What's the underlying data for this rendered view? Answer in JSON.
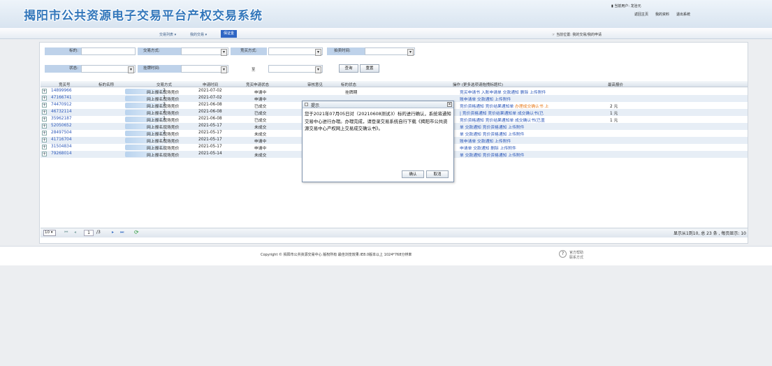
{
  "header": {
    "title": "揭阳市公共资源电子交易平台产权交易系统",
    "user": "▮ 当前用户: 龙治元",
    "links": [
      "返回主页",
      "我的资料",
      "退出系统"
    ]
  },
  "nav": {
    "items": [
      "交易列表 ▾",
      "我的交易 ▾"
    ],
    "active": "保证金",
    "location": "当前位置: 我的交易/我的申请"
  },
  "filters": {
    "target_label": "标的:",
    "trade_label": "交易方式:",
    "bid_label": "竞买方式:",
    "auction_label": "拍卖时间:",
    "status_label": "状态:",
    "list_label": "挂牌时间:",
    "to": "至",
    "query": "查询",
    "reset": "重置"
  },
  "table": {
    "headers": [
      "竞买号",
      "标的名称",
      "交易方式",
      "申请时间",
      "竞买申请状态",
      "审核意见",
      "标的状态",
      "操作 (更多选项请拖拽标题栏)",
      "最高报价"
    ],
    "rows": [
      {
        "id": "14899966",
        "nm": "2",
        "mode": "网上报名现场竞价",
        "date": "2021-07-02",
        "st": "申请中",
        "ts": "挂牌期",
        "ops": "竞买申请书 入账申请单 交款通知 删除 上传附件",
        "opx": "",
        "price": ""
      },
      {
        "id": "47166741",
        "nm": "1",
        "mode": "网上报名现场竞价",
        "date": "2021-07-02",
        "st": "申请中",
        "ts": "",
        "ops": "账申请单 交款通知 上传附件",
        "opx": "",
        "price": ""
      },
      {
        "id": "74470912",
        "nm": "3",
        "mode": "网上报名现场竞价",
        "date": "2021-06-08",
        "st": "已成交",
        "ts": "",
        "ops": "竞价资格通知 竞价结果通知单",
        "opx": "办理成交确认书 上",
        "price": "2 元"
      },
      {
        "id": "46732114",
        "nm": "2",
        "mode": "网上报名现场竞价",
        "date": "2021-06-08",
        "st": "已成交",
        "ts": "",
        "ops": "| 竞价资格通知 竞价结果通知单 成交确认书(已",
        "opx": "",
        "price": "1 元"
      },
      {
        "id": "35962187",
        "nm": "1",
        "mode": "网上报名现场竞价",
        "date": "2021-06-08",
        "st": "已成交",
        "ts": "",
        "ops": "竞价资格通知 竞价结果通知单 成交确认书(已盖",
        "opx": "",
        "price": "1 元"
      },
      {
        "id": "52050652",
        "nm": "",
        "mode": "网上报名现场竞价",
        "date": "2021-05-17",
        "st": "未成交",
        "ts": "",
        "ops": "单 交款通知 竞价资格通知 上传附件",
        "opx": "",
        "price": ""
      },
      {
        "id": "28497504",
        "nm": "2",
        "mode": "网上报名现场竞价",
        "date": "2021-05-17",
        "st": "未成交",
        "ts": "",
        "ops": "单 交款通知 竞价资格通知 上传附件",
        "opx": "",
        "price": ""
      },
      {
        "id": "41716704",
        "nm": "1",
        "mode": "网上报名现场竞价",
        "date": "2021-05-17",
        "st": "申请中",
        "ts": "",
        "ops": "账申请单 交款通知 上传附件",
        "opx": "",
        "price": ""
      },
      {
        "id": "31504834",
        "nm": "",
        "mode": "网上报名现场竞价",
        "date": "2021-05-17",
        "st": "申请中",
        "ts": "",
        "ops": "申请单 交款通知 删除 上传附件",
        "opx": "",
        "price": ""
      },
      {
        "id": "79268014",
        "nm": "",
        "mode": "网上报名现场竞价",
        "date": "2021-05-14",
        "st": "未成交",
        "ts": "",
        "ops": "单 交款通知 竞价资格通知 上传附件",
        "opx": "",
        "price": ""
      }
    ]
  },
  "pager": {
    "size": "10",
    "page": "1",
    "total": "/3",
    "summary": "显示从1到10, 总 23 条 , 每页显示: 10"
  },
  "footer": {
    "copyright": "Copyright © 揭阳市公共资源交易中心 版权所有 最佳浏览效果:IE8.0版本以上 1024*768分辨率",
    "contact": "官方帮助 联系方式"
  },
  "dialog": {
    "title": "提示",
    "message": "您于2021年07月05日对（20210608测试3）标的进行确认，系统将通知交易中心进行办理。办理完成，请登录交易系统自行下载《揭阳市公共资源交易中心产权网上交易成交确认书》。",
    "ok": "确认",
    "cancel": "取消"
  }
}
